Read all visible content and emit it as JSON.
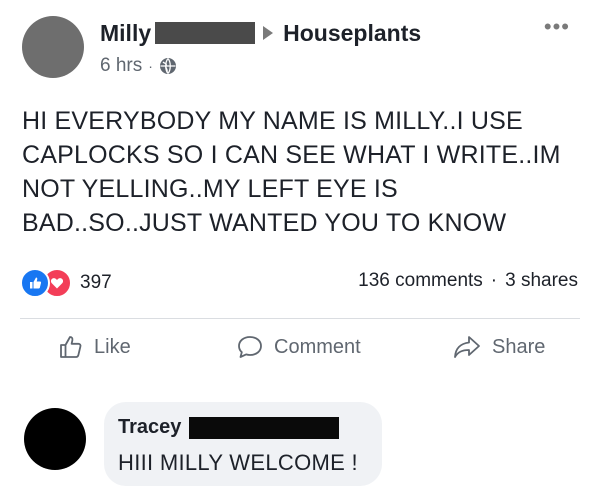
{
  "post": {
    "author": "Milly",
    "group": "Houseplants",
    "time": "6 hrs",
    "meta_separator": "·",
    "privacy_icon": "globe-icon",
    "more_icon": "more-dots-icon",
    "text": "HI EVERYBODY MY NAME IS MILLY..I USE CAPLOCKS SO I CAN SEE WHAT I WRITE..IM NOT YELLING..MY LEFT EYE IS BAD..SO..JUST WANTED YOU TO KNOW"
  },
  "reactions": {
    "icons": [
      "like-reaction-icon",
      "love-reaction-icon"
    ],
    "count": "397",
    "comments": "136 comments",
    "separator": "·",
    "shares": "3 shares"
  },
  "actions": {
    "like": "Like",
    "comment": "Comment",
    "share": "Share"
  },
  "comment": {
    "author": "Tracey",
    "text": "HIII MILLY WELCOME !"
  },
  "colors": {
    "like_blue": "#1877f2",
    "love_red": "#f33e58",
    "bubble_bg": "#f0f2f5",
    "secondary_text": "#606770"
  }
}
